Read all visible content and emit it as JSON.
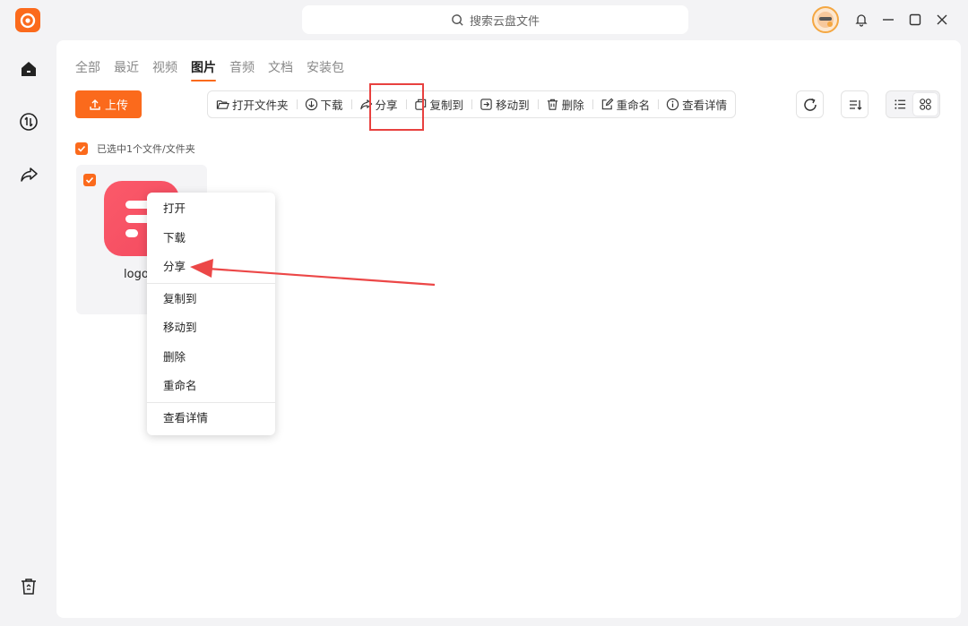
{
  "titlebar": {
    "search_placeholder": "搜索云盘文件"
  },
  "tabs": [
    "全部",
    "最近",
    "视频",
    "图片",
    "音频",
    "文档",
    "安装包"
  ],
  "active_tab": "图片",
  "upload_label": "上传",
  "toolbar": [
    {
      "label": "打开文件夹",
      "icon": "folder-open-icon"
    },
    {
      "label": "下载",
      "icon": "download-icon"
    },
    {
      "label": "分享",
      "icon": "share-icon"
    },
    {
      "label": "复制到",
      "icon": "copy-icon"
    },
    {
      "label": "移动到",
      "icon": "move-icon"
    },
    {
      "label": "删除",
      "icon": "trash-icon"
    },
    {
      "label": "重命名",
      "icon": "rename-icon"
    },
    {
      "label": "查看详情",
      "icon": "info-icon"
    }
  ],
  "selection_text": "已选中1个文件/文件夹",
  "file": {
    "name": "logo.p"
  },
  "context_menu": {
    "group1": [
      "打开",
      "下载",
      "分享"
    ],
    "group2": [
      "复制到",
      "移动到",
      "删除",
      "重命名"
    ],
    "group3": [
      "查看详情"
    ]
  },
  "colors": {
    "accent": "#fb6a1c",
    "highlight": "#e8413f"
  }
}
